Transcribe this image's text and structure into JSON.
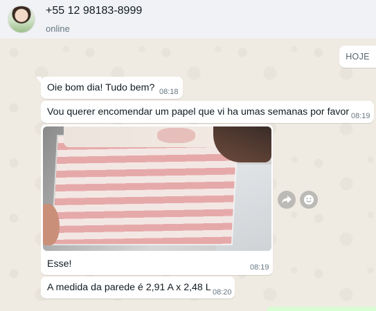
{
  "header": {
    "contact_name": "+55 12 98183-8999",
    "status": "online"
  },
  "date_chip": "HOJE",
  "messages": [
    {
      "text": "Oie bom dia! Tudo bem?",
      "time": "08:18"
    },
    {
      "text": "Vou querer encomendar um papel que vi ha umas semanas por favor",
      "time": "08:19"
    },
    {
      "caption": "Esse!",
      "time": "08:19",
      "image": "photo of pink and white striped wallpaper roll"
    },
    {
      "text": "A medida da parede é 2,91 A x 2,48 L",
      "time": "08:20"
    }
  ],
  "icons": {
    "forward": "forward-icon",
    "emoji": "emoji-reaction-icon"
  },
  "colors": {
    "header_bg": "#f0f2f5",
    "chat_bg": "#efeae2",
    "bubble_in": "#ffffff",
    "bubble_out": "#d9fdd3"
  }
}
